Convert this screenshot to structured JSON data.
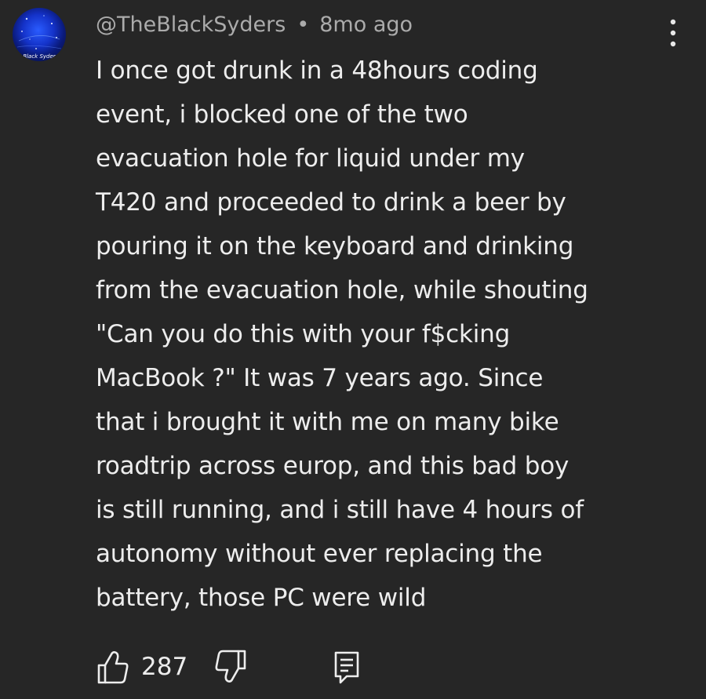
{
  "comment": {
    "username": "@TheBlackSyders",
    "separator": "•",
    "timestamp": "8mo ago",
    "avatar_text": "Black Syder",
    "text_lines": [
      "I once got drunk in a 48hours coding",
      "event, i blocked one of the two",
      "evacuation hole for liquid under my",
      "T420 and proceeded to drink a beer by",
      "pouring it on the keyboard and drinking",
      "from the evacuation hole, while shouting",
      "\"Can you do this with your f$cking",
      "MacBook ?\" It was 7 years ago. Since",
      "that i brought it with me on many bike",
      "roadtrip across europ, and this bad boy",
      "is still running, and i still have 4 hours of",
      "autonomy without ever replacing the",
      "battery, those PC were wild"
    ],
    "like_count": "287"
  },
  "icons": {
    "avatar": "avatar-image",
    "more": "more-vertical-icon",
    "like": "thumbs-up-icon",
    "dislike": "thumbs-down-icon",
    "reply": "reply-comment-icon"
  },
  "colors": {
    "background": "#262626",
    "primary_text": "#ededed",
    "secondary_text": "#ababab"
  }
}
